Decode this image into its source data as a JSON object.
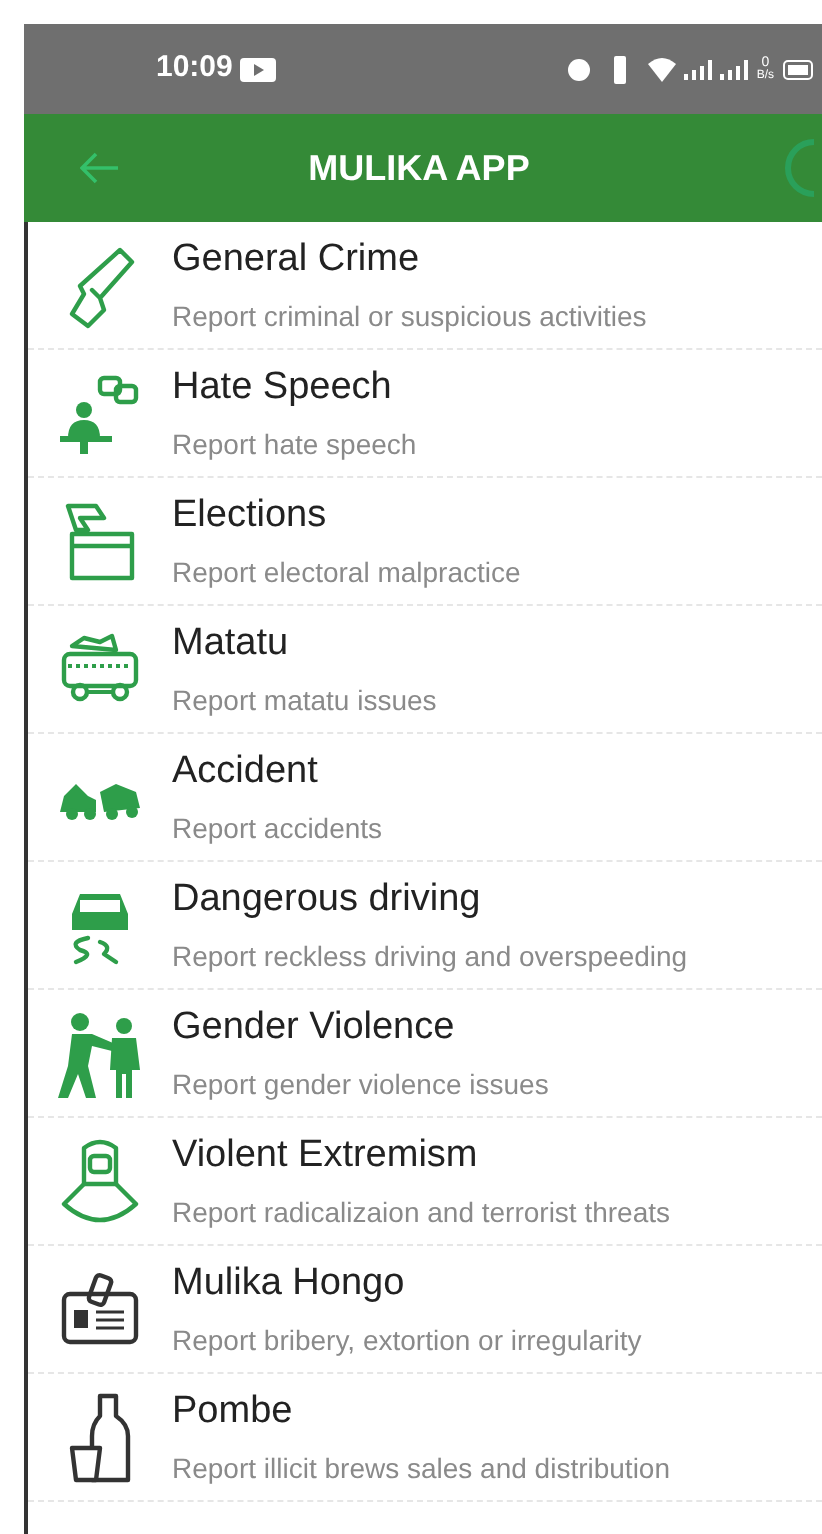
{
  "status_bar": {
    "time": "10:09",
    "net_speed_value": "0",
    "net_speed_unit": "B/s"
  },
  "app_bar": {
    "title": "MULIKA APP"
  },
  "items": [
    {
      "kind": "gun",
      "title": "General Crime",
      "subtitle": "Report criminal or suspicious activities"
    },
    {
      "kind": "speaker",
      "title": "Hate Speech",
      "subtitle": "Report hate speech"
    },
    {
      "kind": "ballot",
      "title": "Elections",
      "subtitle": "Report electoral malpractice"
    },
    {
      "kind": "bus",
      "title": "Matatu",
      "subtitle": "Report matatu issues"
    },
    {
      "kind": "crash",
      "title": "Accident",
      "subtitle": "Report accidents"
    },
    {
      "kind": "skid",
      "title": "Dangerous driving",
      "subtitle": "Report reckless driving and overspeeding"
    },
    {
      "kind": "fight",
      "title": "Gender Violence",
      "subtitle": "Report gender violence issues"
    },
    {
      "kind": "hooded",
      "title": "Violent Extremism",
      "subtitle": "Report radicalizaion and terrorist threats"
    },
    {
      "kind": "badge",
      "title": "Mulika Hongo",
      "subtitle": "Report bribery, extortion or irregularity"
    },
    {
      "kind": "bottle",
      "title": "Pombe",
      "subtitle": "Report illicit brews sales and distribution"
    }
  ]
}
